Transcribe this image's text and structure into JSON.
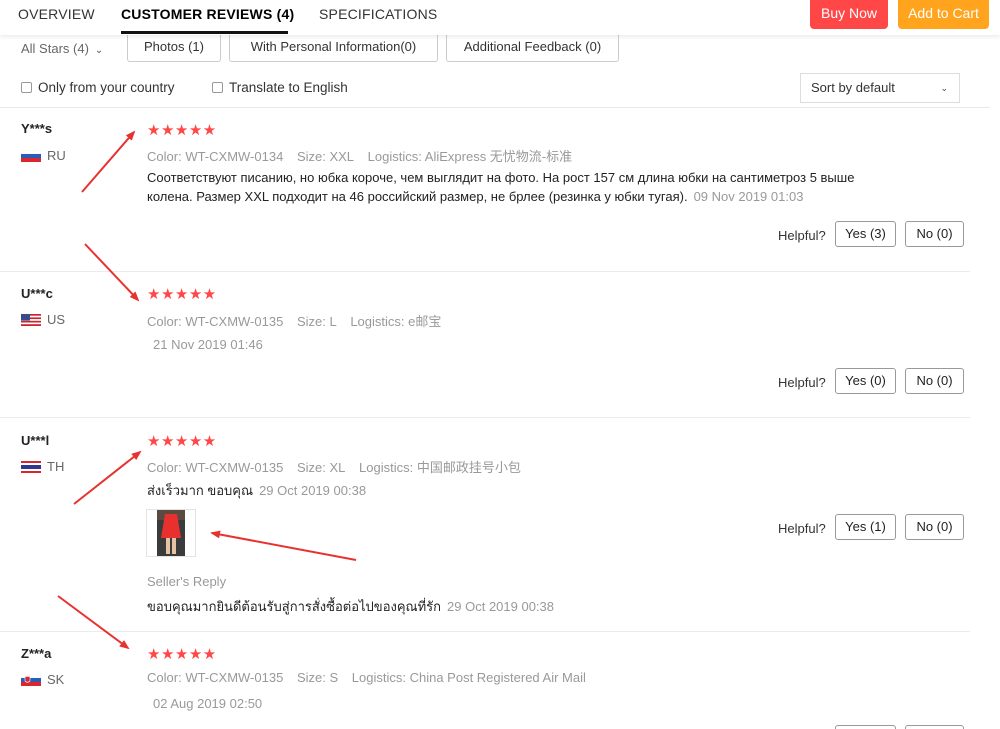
{
  "tabs": {
    "overview": "OVERVIEW",
    "reviews": "CUSTOMER REVIEWS (4)",
    "specs": "SPECIFICATIONS",
    "buy_now": "Buy Now",
    "add_to_cart": "Add to Cart"
  },
  "filters": {
    "all_stars": "All Stars (4)",
    "photos": "Photos (1)",
    "personal_info": "With Personal Information(0)",
    "additional": "Additional Feedback (0)",
    "only_country": "Only from your country",
    "translate": "Translate to English",
    "sort": "Sort by default"
  },
  "labels": {
    "color": "Color:",
    "size": "Size:",
    "logistics": "Logistics:",
    "helpful": "Helpful?",
    "seller_reply": "Seller's Reply"
  },
  "stars_glyph": "★★★★★",
  "reviews": [
    {
      "user": "Y***s",
      "country": "RU",
      "color": "WT-CXMW-0134",
      "size": "XXL",
      "logistics": "AliExpress 无忧物流-标准",
      "text": "Соответствуют писанию, но юбка короче, чем выглядит на фото. На рост 157 см длина юбки на сантиметроз 5 выше колена. Размер XXL подходит на 46 российский размер, не брлее (резинка у юбки тугая).",
      "date": "09 Nov 2019 01:03",
      "yes": "Yes (3)",
      "no": "No (0)"
    },
    {
      "user": "U***c",
      "country": "US",
      "color": "WT-CXMW-0135",
      "size": "L",
      "logistics": "e邮宝",
      "text": "",
      "date": "21 Nov 2019 01:46",
      "yes": "Yes (0)",
      "no": "No (0)"
    },
    {
      "user": "U***l",
      "country": "TH",
      "color": "WT-CXMW-0135",
      "size": "XL",
      "logistics": "中国邮政挂号小包",
      "text": "ส่งเร็วมาก ขอบคุณ",
      "date": "29 Oct 2019 00:38",
      "yes": "Yes (1)",
      "no": "No (0)",
      "reply_text": "ขอบคุณมากยินดีต้อนรับสู่การสั่งซื้อต่อไปของคุณที่รัก",
      "reply_date": "29 Oct 2019 00:38"
    },
    {
      "user": "Z***a",
      "country": "SK",
      "color": "WT-CXMW-0135",
      "size": "S",
      "logistics": "China Post Registered Air Mail",
      "text": "",
      "date": "02 Aug 2019 02:50"
    }
  ],
  "colors": {
    "buy_now": "#ff4747",
    "add_to_cart": "#ffa41c",
    "stars": "#ff4747",
    "arrows": "#e8322f"
  }
}
